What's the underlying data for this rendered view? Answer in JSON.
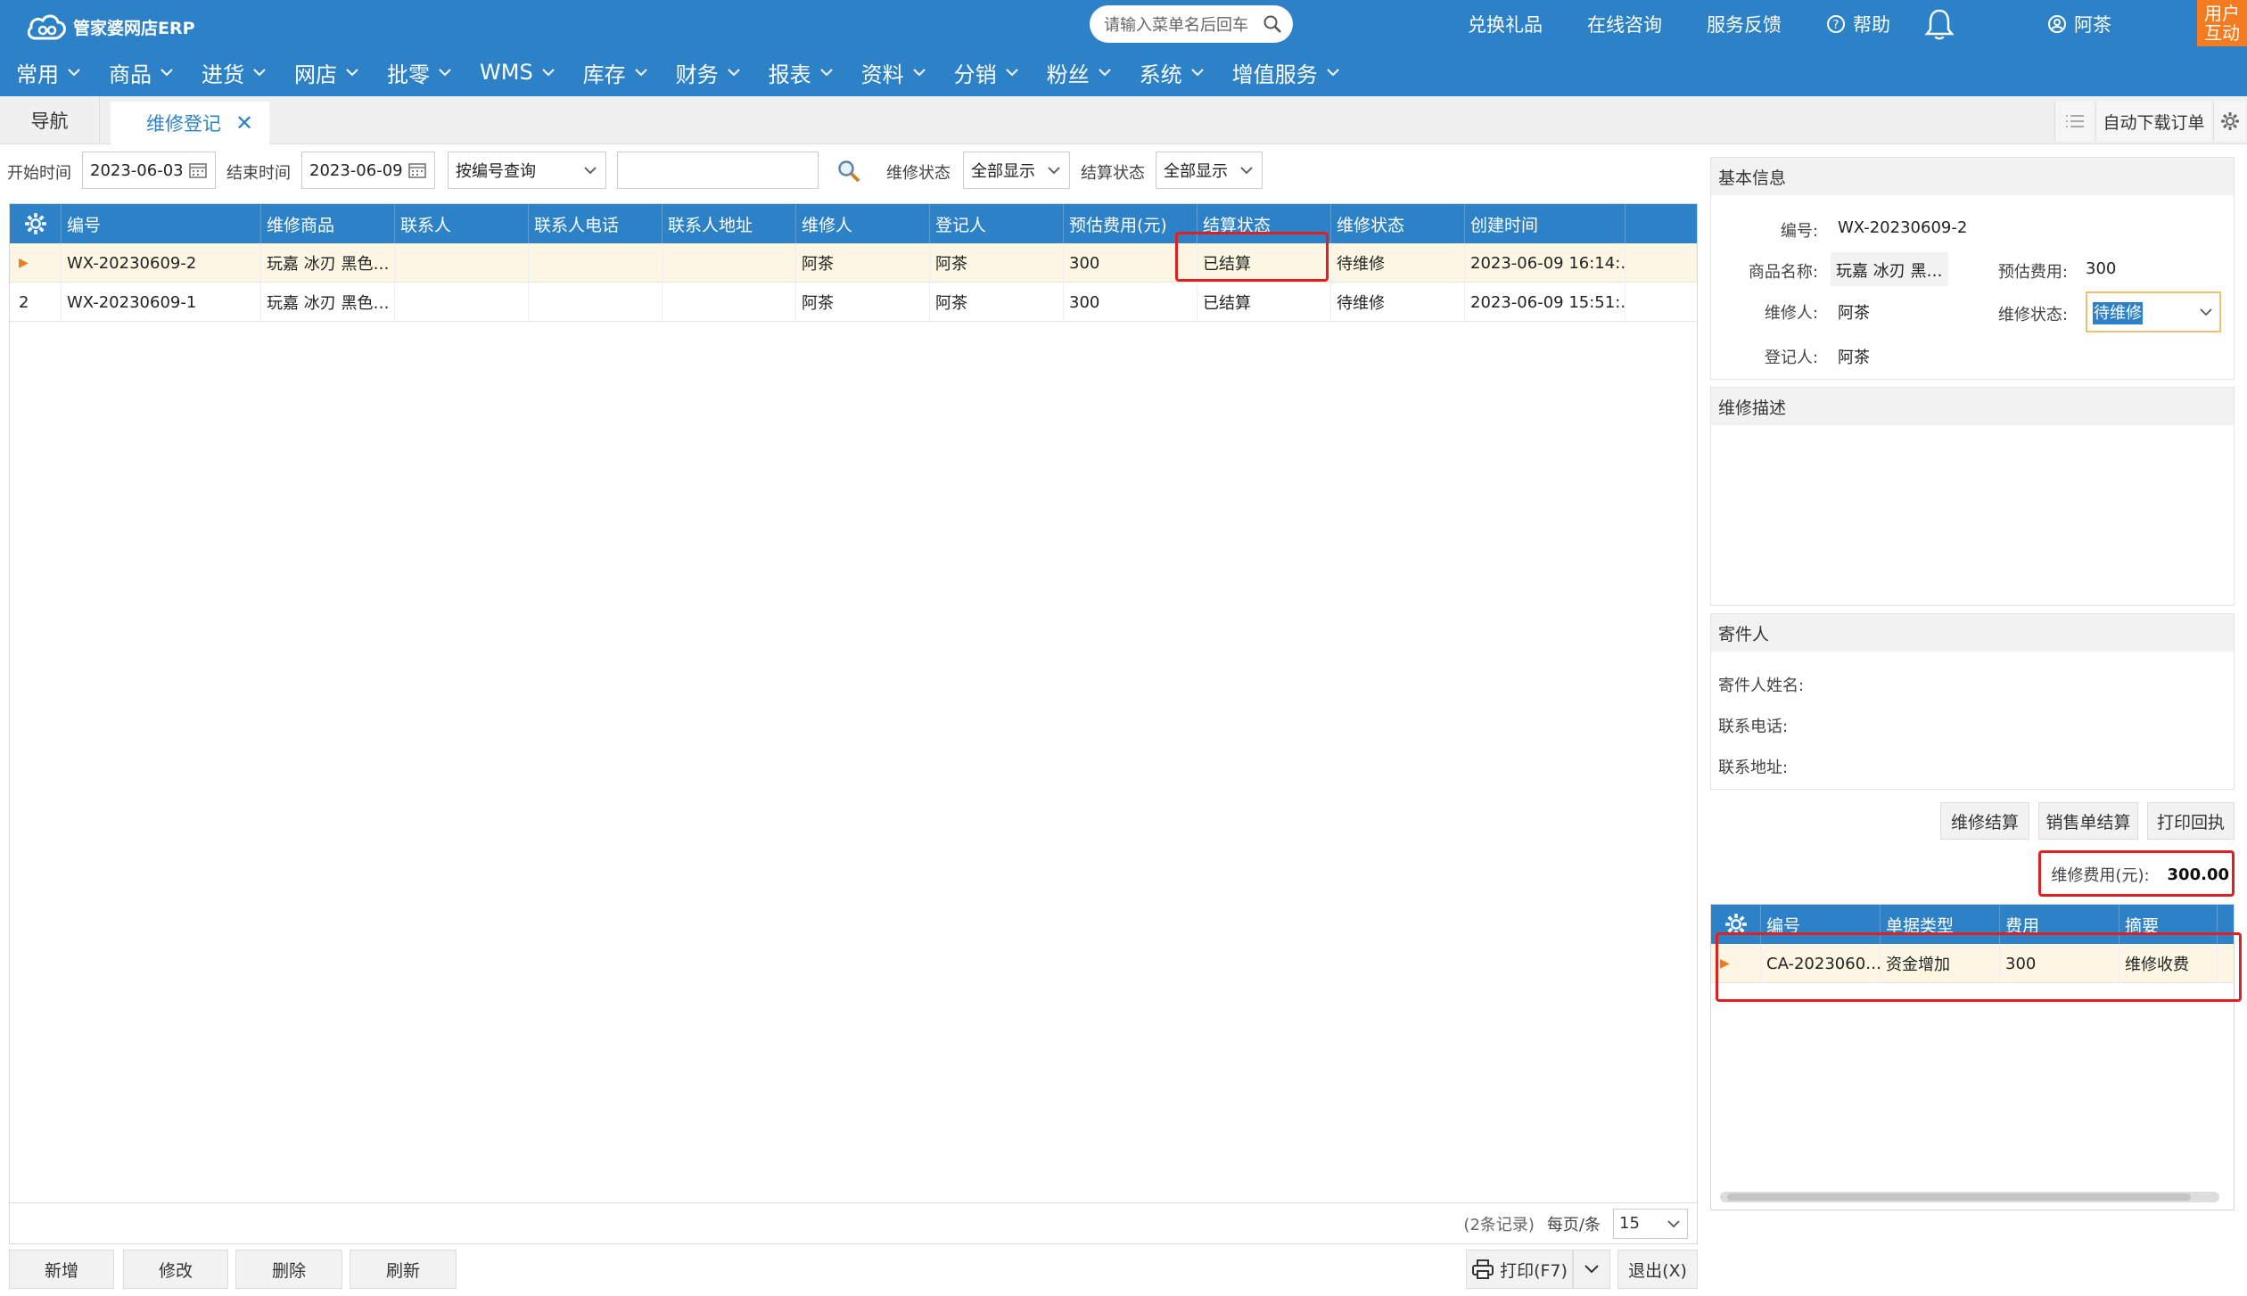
{
  "header": {
    "logo_text": "管家婆网店ERP",
    "search_placeholder": "请输入菜单名后回车",
    "links": {
      "gift": "兑换礼品",
      "consult": "在线咨询",
      "feedback": "服务反馈",
      "help": "帮助",
      "user": "阿茶"
    },
    "corner": [
      "用户",
      "互动"
    ],
    "menu": [
      "常用",
      "商品",
      "进货",
      "网店",
      "批零",
      "WMS",
      "库存",
      "财务",
      "报表",
      "资料",
      "分销",
      "粉丝",
      "系统",
      "增值服务"
    ]
  },
  "tabs": {
    "nav": "导航",
    "active": "维修登记",
    "auto_download": "自动下载订单"
  },
  "filter": {
    "start_label": "开始时间",
    "start_value": "2023-06-03",
    "end_label": "结束时间",
    "end_value": "2023-06-09",
    "query_type": "按编号查询",
    "query_value": "",
    "repair_status_label": "维修状态",
    "repair_status_value": "全部显示",
    "settle_status_label": "结算状态",
    "settle_status_value": "全部显示"
  },
  "main_grid": {
    "columns": [
      "编号",
      "维修商品",
      "联系人",
      "联系人电话",
      "联系人地址",
      "维修人",
      "登记人",
      "预估费用(元)",
      "结算状态",
      "维修状态",
      "创建时间"
    ],
    "rows": [
      {
        "marker": "▶",
        "cells": [
          "WX-20230609-2",
          "玩嘉 冰刃 黑色…",
          "",
          "",
          "",
          "阿茶",
          "阿茶",
          "300",
          "已结算",
          "待维修",
          "2023-06-09 16:14:…"
        ]
      },
      {
        "marker": "2",
        "cells": [
          "WX-20230609-1",
          "玩嘉 冰刃 黑色…",
          "",
          "",
          "",
          "阿茶",
          "阿茶",
          "300",
          "已结算",
          "待维修",
          "2023-06-09 15:51:…"
        ]
      }
    ]
  },
  "pager": {
    "records": "(2条记录)",
    "per_page_label": "每页/条",
    "per_page_value": "15"
  },
  "bottom_buttons": {
    "add": "新增",
    "edit": "修改",
    "delete": "删除",
    "refresh": "刷新",
    "print": "打印(F7)",
    "exit": "退出(X)"
  },
  "basic_info": {
    "title": "基本信息",
    "code_label": "编号:",
    "code_value": "WX-20230609-2",
    "product_label": "商品名称:",
    "product_value": "玩嘉 冰刃 黑…",
    "est_label": "预估费用:",
    "est_value": "300",
    "repairer_label": "维修人:",
    "repairer_value": "阿茶",
    "status_label": "维修状态:",
    "status_value": "待维修",
    "registrar_label": "登记人:",
    "registrar_value": "阿茶"
  },
  "repair_desc": {
    "title": "维修描述"
  },
  "sender": {
    "title": "寄件人",
    "name_label": "寄件人姓名:",
    "phone_label": "联系电话:",
    "address_label": "联系地址:"
  },
  "action_buttons": {
    "settle": "维修结算",
    "sales_settle": "销售单结算",
    "print_receipt": "打印回执"
  },
  "fee": {
    "label": "维修费用(元):",
    "value": "300.00"
  },
  "sub_grid": {
    "columns": [
      "编号",
      "单据类型",
      "费用",
      "摘要"
    ],
    "rows": [
      {
        "marker": "▶",
        "cells": [
          "CA-2023060…",
          "资金增加",
          "300",
          "维修收费"
        ]
      }
    ]
  },
  "colors": {
    "primary": "#2d82c7",
    "accent": "#f47b20",
    "highlight": "#e02020",
    "selected_row": "#fdf6e3"
  }
}
